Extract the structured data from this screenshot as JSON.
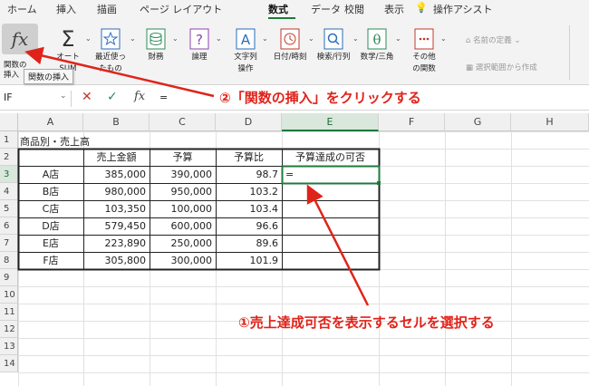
{
  "tabs": [
    "ホーム",
    "挿入",
    "描画",
    "ページ レイアウト",
    "数式",
    "データ",
    "校閲",
    "表示",
    "操作アシスト"
  ],
  "ribbon": {
    "fx_label_1": "関数の",
    "fx_label_2": "挿入",
    "tooltip": "関数の挿入",
    "autosum_1": "オート",
    "autosum_2": "SUM",
    "recent_1": "最近使っ",
    "recent_2": "たもの",
    "financial": "財務",
    "logical": "論理",
    "text_1": "文字列",
    "text_2": "操作",
    "datetime": "日付/時刻",
    "lookup": "検索/行列",
    "math": "数学/三角",
    "other_1": "その他",
    "other_2": "の関数",
    "define_name": "名前の定義",
    "create_from_selection": "選択範囲から作成"
  },
  "formula_bar": {
    "name_box": "IF",
    "value": "="
  },
  "columns": [
    "A",
    "B",
    "C",
    "D",
    "E",
    "F",
    "G",
    "H"
  ],
  "rows": [
    "1",
    "2",
    "3",
    "4",
    "5",
    "6",
    "7",
    "8",
    "9",
    "10",
    "11",
    "12",
    "13",
    "14"
  ],
  "sheet": {
    "title": "商品別・売上高",
    "headers": [
      "売上金額",
      "予算",
      "予算比",
      "予算達成の可否"
    ],
    "data": [
      {
        "store": "A店",
        "sales": "385,000",
        "budget": "390,000",
        "ratio": "98.7",
        "result": "="
      },
      {
        "store": "B店",
        "sales": "980,000",
        "budget": "950,000",
        "ratio": "103.2",
        "result": ""
      },
      {
        "store": "C店",
        "sales": "103,350",
        "budget": "100,000",
        "ratio": "103.4",
        "result": ""
      },
      {
        "store": "D店",
        "sales": "579,450",
        "budget": "600,000",
        "ratio": "96.6",
        "result": ""
      },
      {
        "store": "E店",
        "sales": "223,890",
        "budget": "250,000",
        "ratio": "89.6",
        "result": ""
      },
      {
        "store": "F店",
        "sales": "305,800",
        "budget": "300,000",
        "ratio": "101.9",
        "result": ""
      }
    ]
  },
  "annotations": {
    "step2": "②「関数の挿入」をクリックする",
    "step1": "①売上達成可否を表示するセルを選択する"
  },
  "colors": {
    "accent_green": "#1d7a3a",
    "annotation_red": "#e0231a"
  }
}
